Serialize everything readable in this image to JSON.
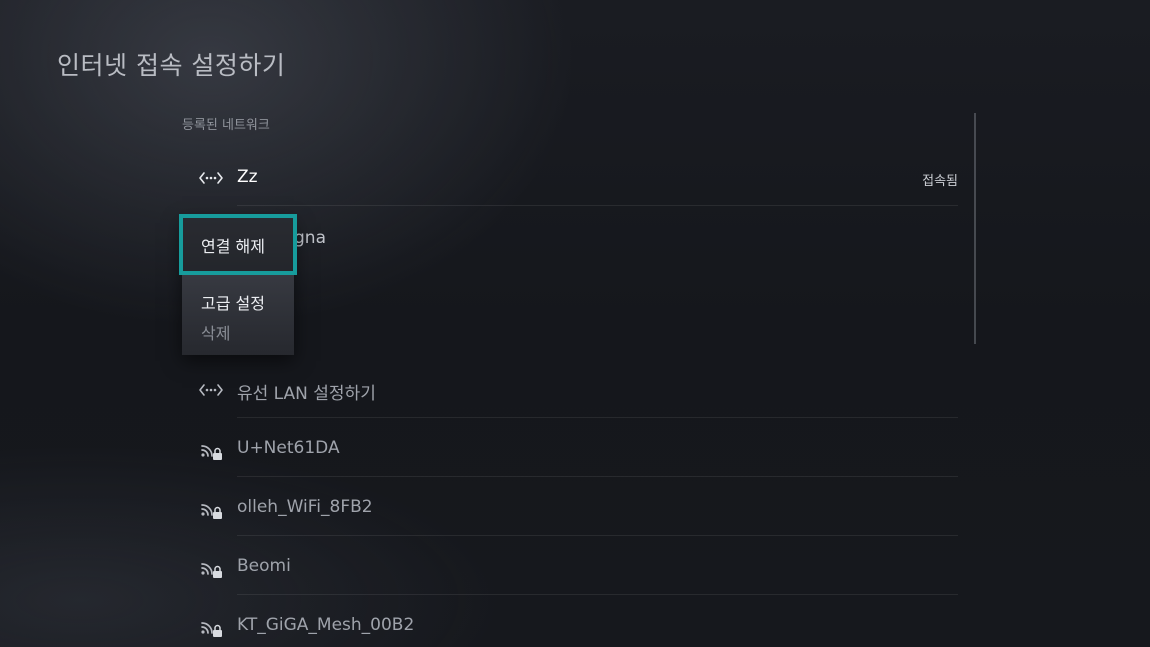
{
  "page": {
    "title": "인터넷 접속 설정하기"
  },
  "registered": {
    "label": "등록된 네트워크",
    "networks": [
      {
        "name": "Zz",
        "status": "접속됨",
        "icon": "wired-ellipsis-icon"
      }
    ],
    "partial_hidden_name": "gna"
  },
  "context_menu": {
    "items": [
      {
        "label": "연결 해제",
        "enabled": true,
        "focused": true
      },
      {
        "label": "고급 설정",
        "enabled": true,
        "focused": false
      },
      {
        "label": "삭제",
        "enabled": false,
        "focused": false
      }
    ],
    "focus_color": "#179c9c"
  },
  "available": [
    {
      "name": "유선 LAN 설정하기",
      "icon": "wired-ellipsis-icon"
    },
    {
      "name": "U+Net61DA",
      "icon": "wifi-locked-icon"
    },
    {
      "name": "olleh_WiFi_8FB2",
      "icon": "wifi-locked-icon"
    },
    {
      "name": "Beomi",
      "icon": "wifi-locked-icon"
    },
    {
      "name": "KT_GiGA_Mesh_00B2",
      "icon": "wifi-locked-icon"
    }
  ]
}
